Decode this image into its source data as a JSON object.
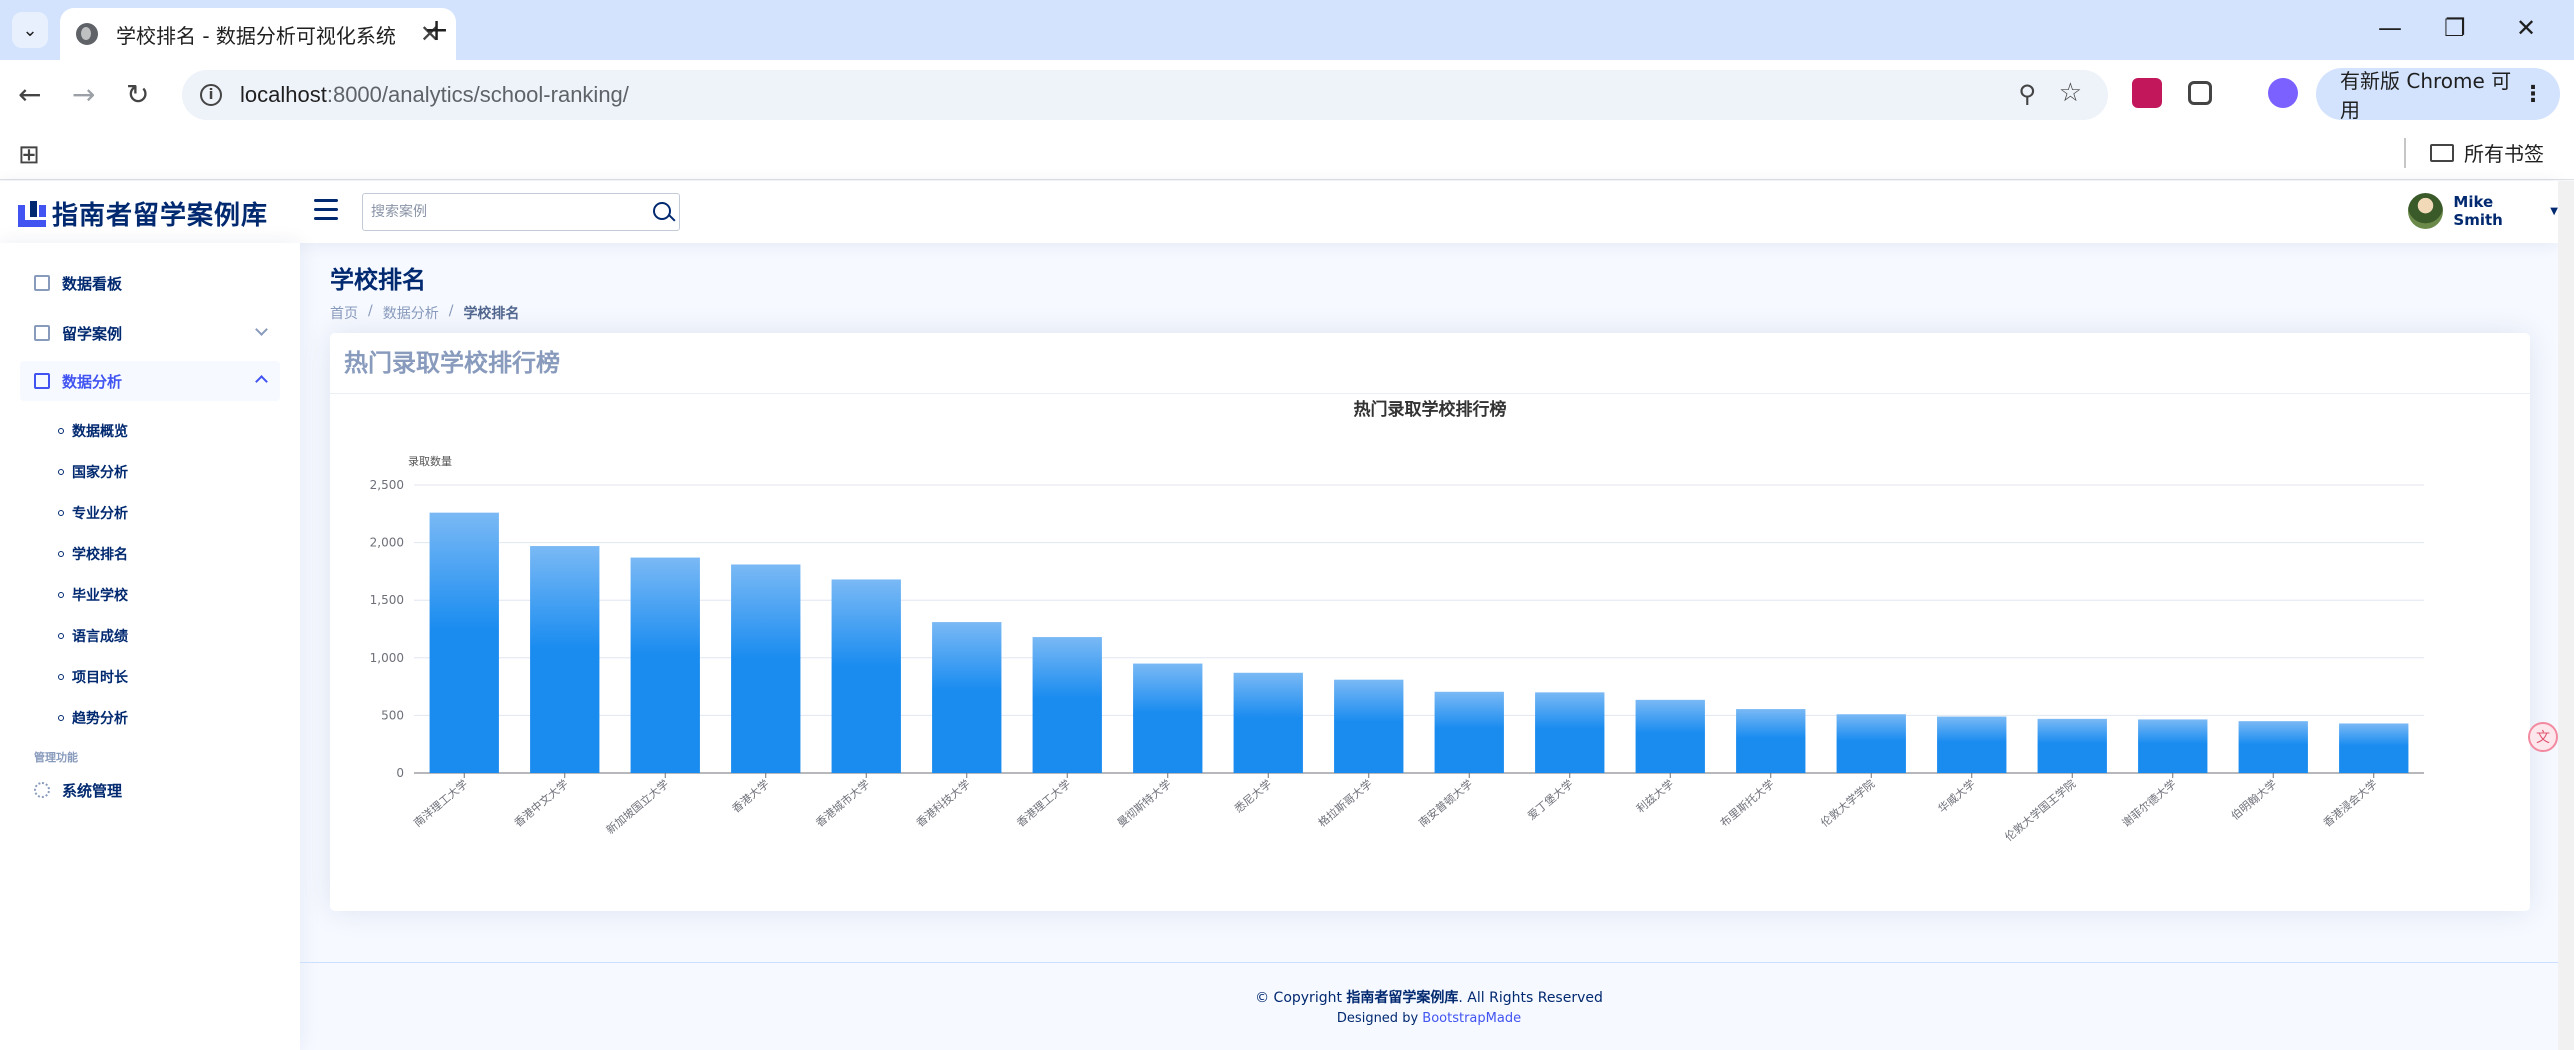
{
  "browser": {
    "tab_title": "学校排名 - 数据分析可视化系统",
    "url_host": "localhost",
    "url_rest": ":8000/analytics/school-ranking/",
    "update_label": "有新版 Chrome 可用",
    "bookmarks_label": "所有书签"
  },
  "header": {
    "logo_text": "指南者留学案例库",
    "search_placeholder": "搜索案例",
    "user_name": "Mike Smith"
  },
  "sidebar": {
    "items": [
      {
        "label": "数据看板"
      },
      {
        "label": "留学案例"
      },
      {
        "label": "数据分析"
      }
    ],
    "sub_items": [
      {
        "label": "数据概览"
      },
      {
        "label": "国家分析"
      },
      {
        "label": "专业分析"
      },
      {
        "label": "学校排名"
      },
      {
        "label": "毕业学校"
      },
      {
        "label": "语言成绩"
      },
      {
        "label": "项目时长"
      },
      {
        "label": "趋势分析"
      }
    ],
    "heading": "管理功能",
    "system_label": "系统管理"
  },
  "page": {
    "title": "学校排名",
    "breadcrumb": [
      "首页",
      "数据分析",
      "学校排名"
    ],
    "card_title": "热门录取学校排行榜"
  },
  "chart_data": {
    "type": "bar",
    "title": "热门录取学校排行榜",
    "ylabel": "录取数量",
    "xlabel": "",
    "ylim": [
      0,
      2500
    ],
    "yticks": [
      0,
      500,
      1000,
      1500,
      2000,
      2500
    ],
    "categories": [
      "南洋理工大学",
      "香港中文大学",
      "新加坡国立大学",
      "香港大学",
      "香港城市大学",
      "香港科技大学",
      "香港理工大学",
      "曼彻斯特大学",
      "悉尼大学",
      "格拉斯哥大学",
      "南安普顿大学",
      "爱丁堡大学",
      "利兹大学",
      "布里斯托大学",
      "伦敦大学学院",
      "华威大学",
      "伦敦大学国王学院",
      "谢菲尔德大学",
      "伯明翰大学",
      "香港浸会大学"
    ],
    "values": [
      2260,
      1970,
      1870,
      1810,
      1680,
      1310,
      1180,
      950,
      870,
      810,
      705,
      700,
      635,
      555,
      510,
      490,
      470,
      465,
      450,
      430
    ],
    "bar_color_top": "#7ab9f5",
    "bar_color_bottom": "#1a8cf0",
    "grid": true
  },
  "footer": {
    "copyright_prefix": "© Copyright ",
    "copyright_brand": "指南者留学案例库",
    "copyright_suffix": ". All Rights Reserved",
    "designed_by": "Designed by ",
    "designer": "BootstrapMade"
  }
}
